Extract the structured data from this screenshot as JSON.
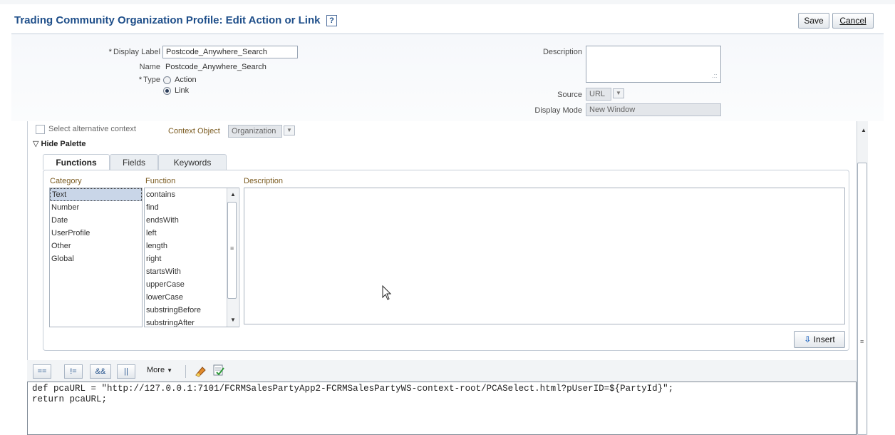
{
  "header": {
    "title": "Trading Community Organization Profile: Edit Action or Link",
    "help_icon": "?",
    "save_label": "Save",
    "cancel_label": "Cancel"
  },
  "form": {
    "required_marker": "*",
    "display_label": {
      "label": "Display Label",
      "value": "Postcode_Anywhere_Search"
    },
    "name": {
      "label": "Name",
      "value": "Postcode_Anywhere_Search"
    },
    "type": {
      "label": "Type",
      "options": [
        "Action",
        "Link"
      ],
      "selected": "Link"
    },
    "description": {
      "label": "Description",
      "value": ""
    },
    "source": {
      "label": "Source",
      "value": "URL"
    },
    "display_mode": {
      "label": "Display Mode",
      "value": "New Window"
    }
  },
  "context": {
    "alt_context_label": "Select alternative context",
    "context_object_label": "Context Object",
    "context_object_value": "Organization"
  },
  "palette": {
    "toggle_label": "Hide Palette",
    "toggle_icon": "▽",
    "tabs": [
      "Functions",
      "Fields",
      "Keywords"
    ],
    "active_tab": "Functions",
    "category_header": "Category",
    "function_header": "Function",
    "description_header": "Description",
    "categories": [
      "Text",
      "Number",
      "Date",
      "UserProfile",
      "Other",
      "Global"
    ],
    "selected_category": "Text",
    "functions": [
      "contains",
      "find",
      "endsWith",
      "left",
      "length",
      "right",
      "startsWith",
      "upperCase",
      "lowerCase",
      "substringBefore",
      "substringAfter"
    ],
    "insert_label": "Insert"
  },
  "operators": {
    "buttons": [
      "==",
      "!=",
      "&&",
      "||"
    ],
    "more_label": "More"
  },
  "code": {
    "line1": "def pcaURL = \"http://127.0.0.1:7101/FCRMSalesPartyApp2-FCRMSalesPartyWS-context-root/PCASelect.html?pUserID=${PartyId}\";",
    "line2": "return pcaURL;"
  },
  "colors": {
    "title": "#1f4f8a",
    "header_band": "#f6f8fb",
    "selected_row": "#c9d6e8",
    "label_brown": "#7a5a1f"
  }
}
